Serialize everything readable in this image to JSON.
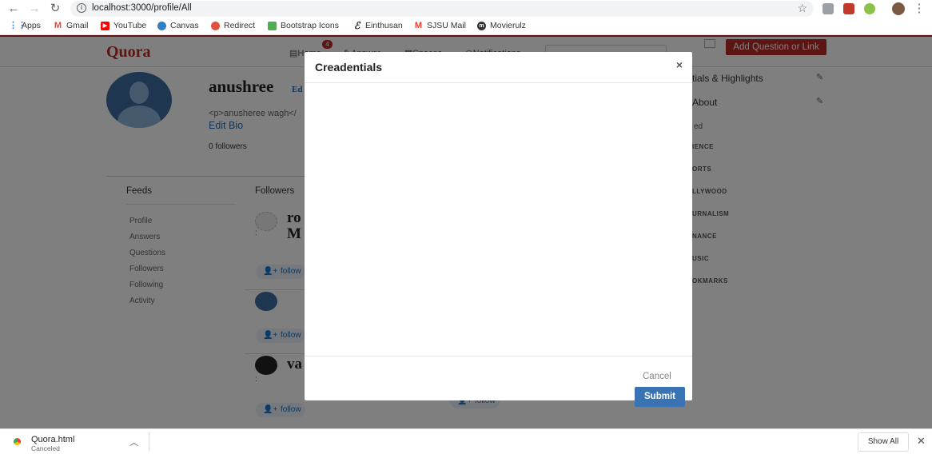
{
  "browser": {
    "url": "localhost:3000/profile/All",
    "bookmarks": [
      {
        "label": "Apps",
        "icon": "apps-grid-icon",
        "color": "#4285f4"
      },
      {
        "label": "Gmail",
        "icon": "gmail-icon",
        "color": "#ea4335"
      },
      {
        "label": "YouTube",
        "icon": "youtube-icon",
        "color": "#ff0000"
      },
      {
        "label": "Canvas",
        "icon": "canvas-icon",
        "color": "#2d7fc6"
      },
      {
        "label": "Redirect",
        "icon": "redirect-icon",
        "color": "#e0533f"
      },
      {
        "label": "Bootstrap Icons",
        "icon": "bootstrap-icon",
        "color": "#4caf50"
      },
      {
        "label": "Einthusan",
        "icon": "einthusan-icon",
        "color": "#222222"
      },
      {
        "label": "SJSU Mail",
        "icon": "gmail-icon",
        "color": "#ea4335"
      },
      {
        "label": "Movierulz",
        "icon": "movierulz-icon",
        "color": "#333333"
      }
    ]
  },
  "app": {
    "logo": "Quora",
    "brand_color": "#b92b27",
    "nav": {
      "home": "Home",
      "answer": "Answer",
      "spaces": "Spaces",
      "notifications": "Notifications",
      "badge_count": "4",
      "add_question": "Add Question or Link"
    },
    "profile": {
      "name": "anushree",
      "edit": "Ed",
      "bio": "<p>anusheree wagh</",
      "edit_bio": "Edit Bio",
      "followers_count": "0 followers"
    },
    "feeds": {
      "title": "Feeds",
      "items": [
        "Profile",
        "Answers",
        "Questions",
        "Followers",
        "Following",
        "Activity"
      ]
    },
    "followers_panel": {
      "title": "Followers",
      "entries": [
        {
          "name_line1": "ro",
          "name_line2": "M",
          "sub": ":",
          "follow": "follow"
        },
        {
          "name_line1": "",
          "name_line2": "",
          "sub": "",
          "follow": "follow"
        },
        {
          "name_line1": "va",
          "name_line2": "",
          "sub": ":",
          "follow": "follow"
        }
      ],
      "extra_follow": "follow"
    },
    "sidebar": {
      "credentials": "tials & Highlights",
      "about": "About",
      "label_ed": "ed",
      "topics": [
        "IENCE",
        "ORTS",
        "LLYWOOD",
        "URNALISM",
        "NANCE",
        "USIC",
        "OKMARKS"
      ]
    }
  },
  "modal": {
    "title": "Creadentials",
    "close": "×",
    "cancel": "Cancel",
    "submit": "Submit"
  },
  "downloads": {
    "file": "Quora.html",
    "status": "Canceled",
    "show_all": "Show All"
  }
}
